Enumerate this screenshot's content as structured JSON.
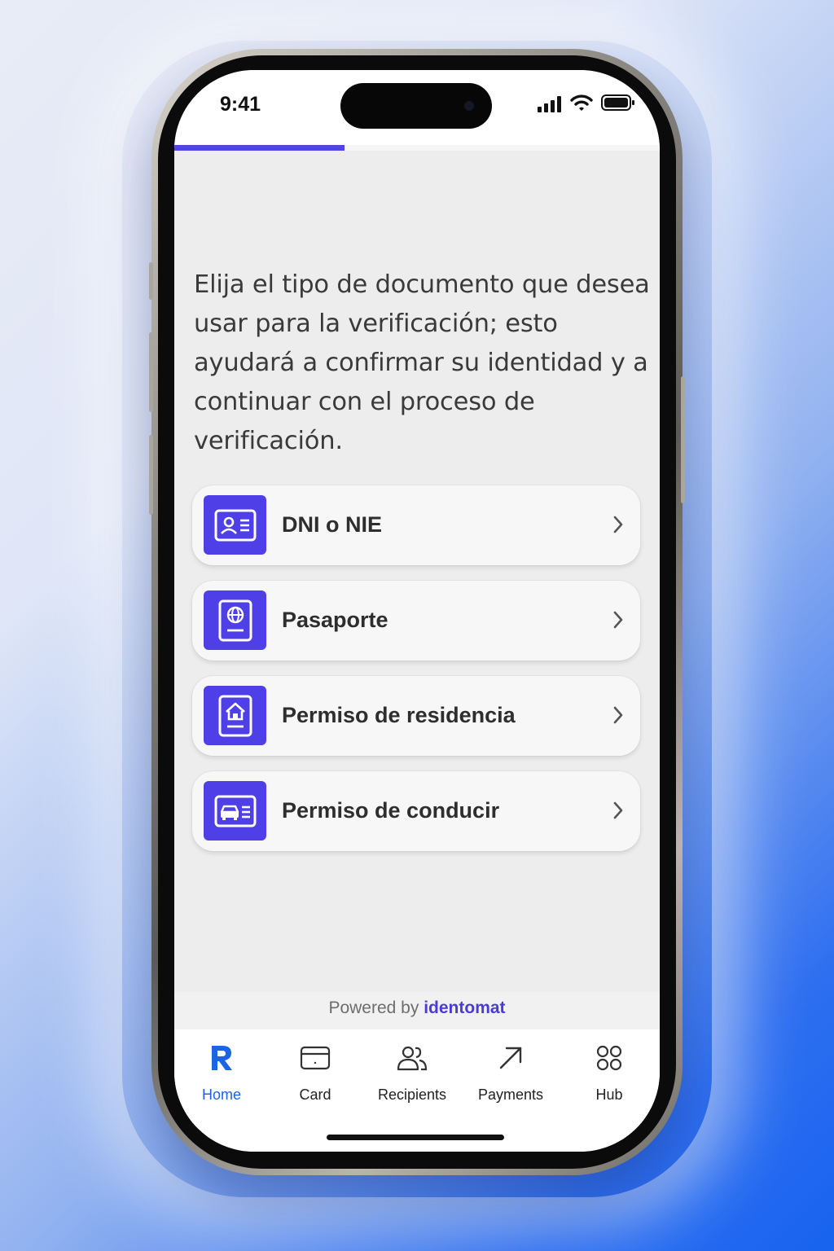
{
  "status_bar": {
    "time": "9:41"
  },
  "verification": {
    "progress": 0.35,
    "intro_text": "Elija el tipo de documento que desea usar para la verificación; esto ayudará a confirmar su identidad y a continuar con el proceso de verificación.",
    "documents": [
      {
        "label": "DNI o NIE",
        "icon": "id-card-icon"
      },
      {
        "label": "Pasaporte",
        "icon": "passport-icon"
      },
      {
        "label": "Permiso de residencia",
        "icon": "residence-permit-icon"
      },
      {
        "label": "Permiso de conducir",
        "icon": "driving-license-icon"
      }
    ],
    "powered_by": "Powered by",
    "powered_brand": "identomat"
  },
  "tab_bar": {
    "tabs": [
      {
        "label": "Home",
        "icon": "revolut-logo-icon",
        "active": true
      },
      {
        "label": "Card",
        "icon": "card-icon",
        "active": false
      },
      {
        "label": "Recipients",
        "icon": "recipients-icon",
        "active": false
      },
      {
        "label": "Payments",
        "icon": "arrow-up-right-icon",
        "active": false
      },
      {
        "label": "Hub",
        "icon": "grid-icon",
        "active": false
      }
    ]
  },
  "colors": {
    "accent": "#4f3fe6",
    "active_tab": "#1d63e6",
    "progress": "#5045e0"
  }
}
